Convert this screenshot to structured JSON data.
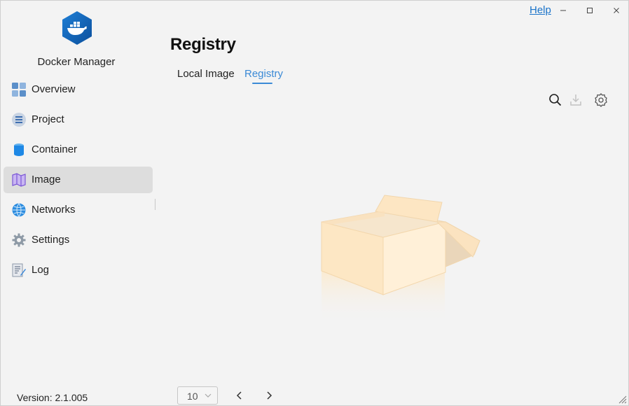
{
  "app": {
    "name": "Docker Manager",
    "version": "Version: 2.1.005"
  },
  "window": {
    "help_label": "Help"
  },
  "sidebar": {
    "items": [
      {
        "label": "Overview",
        "icon": "overview-icon"
      },
      {
        "label": "Project",
        "icon": "project-icon"
      },
      {
        "label": "Container",
        "icon": "container-icon"
      },
      {
        "label": "Image",
        "icon": "image-icon",
        "active": true
      },
      {
        "label": "Networks",
        "icon": "networks-icon"
      },
      {
        "label": "Settings",
        "icon": "settings-icon"
      },
      {
        "label": "Log",
        "icon": "log-icon"
      }
    ]
  },
  "main": {
    "title": "Registry",
    "tabs": [
      {
        "label": "Local Image",
        "active": false
      },
      {
        "label": "Registry",
        "active": true
      }
    ],
    "toolbar": {
      "icons": [
        "search-icon",
        "download-icon",
        "gear-icon"
      ]
    },
    "empty_state_icon": "empty-box-icon"
  },
  "pagination": {
    "page_size": "10"
  },
  "colors": {
    "accent": "#3b8ad6",
    "active_nav_bg": "#dddddd",
    "link": "#1a73c9"
  }
}
